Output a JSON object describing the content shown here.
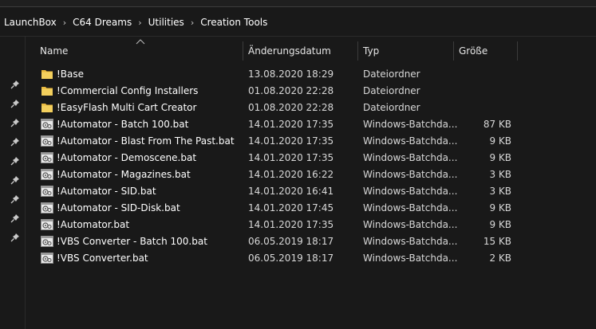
{
  "breadcrumbs": [
    "LaunchBox",
    "C64 Dreams",
    "Utilities",
    "Creation Tools"
  ],
  "columns": {
    "name": "Name",
    "date": "Änderungsdatum",
    "type": "Typ",
    "size": "Größe"
  },
  "sort": {
    "column": "name",
    "direction": "ascending"
  },
  "files": [
    {
      "name": "!Base",
      "date": "13.08.2020 18:29",
      "type": "Dateiordner",
      "size": "",
      "kind": "folder"
    },
    {
      "name": "!Commercial Config Installers",
      "date": "01.08.2020 22:28",
      "type": "Dateiordner",
      "size": "",
      "kind": "folder"
    },
    {
      "name": "!EasyFlash Multi Cart Creator",
      "date": "01.08.2020 22:28",
      "type": "Dateiordner",
      "size": "",
      "kind": "folder"
    },
    {
      "name": "!Automator - Batch 100.bat",
      "date": "14.01.2020 17:35",
      "type": "Windows-Batchda...",
      "size": "87 KB",
      "kind": "batch"
    },
    {
      "name": "!Automator - Blast From The Past.bat",
      "date": "14.01.2020 17:35",
      "type": "Windows-Batchda...",
      "size": "9 KB",
      "kind": "batch"
    },
    {
      "name": "!Automator - Demoscene.bat",
      "date": "14.01.2020 17:35",
      "type": "Windows-Batchda...",
      "size": "9 KB",
      "kind": "batch"
    },
    {
      "name": "!Automator - Magazines.bat",
      "date": "14.01.2020 16:22",
      "type": "Windows-Batchda...",
      "size": "3 KB",
      "kind": "batch"
    },
    {
      "name": "!Automator - SID.bat",
      "date": "14.01.2020 16:41",
      "type": "Windows-Batchda...",
      "size": "3 KB",
      "kind": "batch"
    },
    {
      "name": "!Automator - SID-Disk.bat",
      "date": "14.01.2020 17:45",
      "type": "Windows-Batchda...",
      "size": "9 KB",
      "kind": "batch"
    },
    {
      "name": "!Automator.bat",
      "date": "14.01.2020 17:35",
      "type": "Windows-Batchda...",
      "size": "9 KB",
      "kind": "batch"
    },
    {
      "name": "!VBS Converter - Batch 100.bat",
      "date": "06.05.2019 18:17",
      "type": "Windows-Batchda...",
      "size": "15 KB",
      "kind": "batch"
    },
    {
      "name": "!VBS Converter.bat",
      "date": "06.05.2019 18:17",
      "type": "Windows-Batchda...",
      "size": "2 KB",
      "kind": "batch"
    }
  ],
  "quick_access_pins": 9,
  "icons": {
    "folder": "folder-icon",
    "batch": "batch-file-icon",
    "pin": "pin-icon",
    "sort": "sort-ascending-icon",
    "separator": "chevron-right-icon"
  },
  "colors": {
    "background": "#191919",
    "folder": "#f3cf5d",
    "text": "#ffffff"
  }
}
